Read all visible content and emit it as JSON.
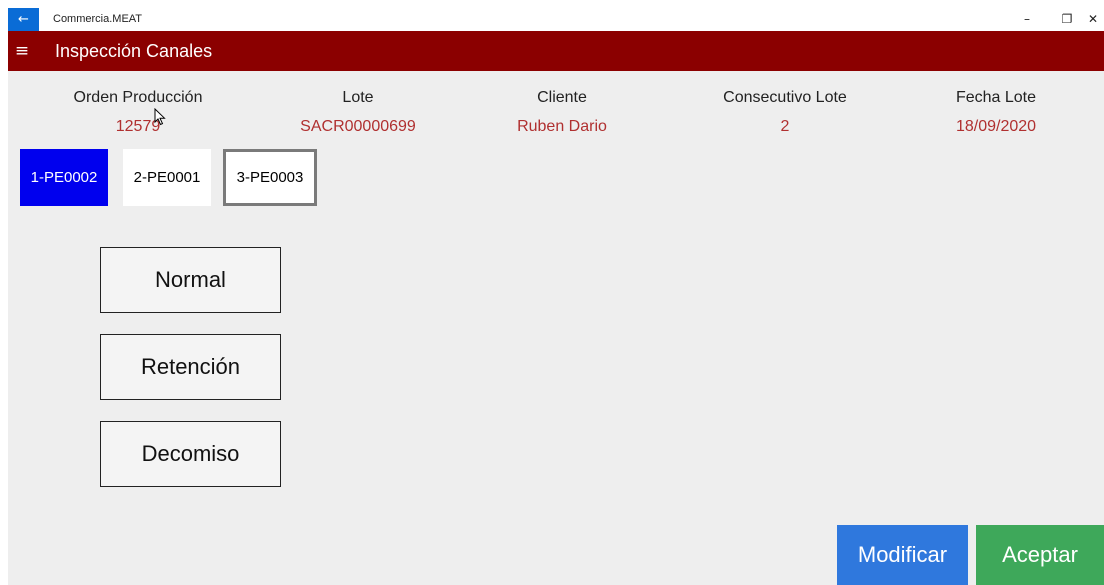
{
  "window": {
    "app_title": "Commercia.MEAT",
    "back_glyph": "←",
    "minimize_glyph": "–",
    "restore_glyph": "❐",
    "close_glyph": "✕"
  },
  "nav": {
    "menu_glyph": "≡",
    "title": "Inspección Canales"
  },
  "info": [
    {
      "label": "Orden Producción",
      "value": "12579"
    },
    {
      "label": "Lote",
      "value": "SACR00000699"
    },
    {
      "label": "Cliente",
      "value": "Ruben Dario"
    },
    {
      "label": "Consecutivo Lote",
      "value": "2"
    },
    {
      "label": "Fecha Lote",
      "value": "18/09/2020"
    }
  ],
  "tabs": [
    {
      "label": "1-PE0002",
      "state": "selected"
    },
    {
      "label": "2-PE0001",
      "state": "normal"
    },
    {
      "label": "3-PE0003",
      "state": "focused"
    }
  ],
  "options": [
    "Normal",
    "Retención",
    "Decomiso"
  ],
  "actions": {
    "modify": "Modificar",
    "accept": "Aceptar"
  },
  "colors": {
    "nav_bar": "#8b0000",
    "value_text": "#b03030",
    "tab_selected": "#0000ee",
    "modify_button": "#2f78dd",
    "accept_button": "#3ea85a",
    "back_button": "#0a6cd6"
  }
}
